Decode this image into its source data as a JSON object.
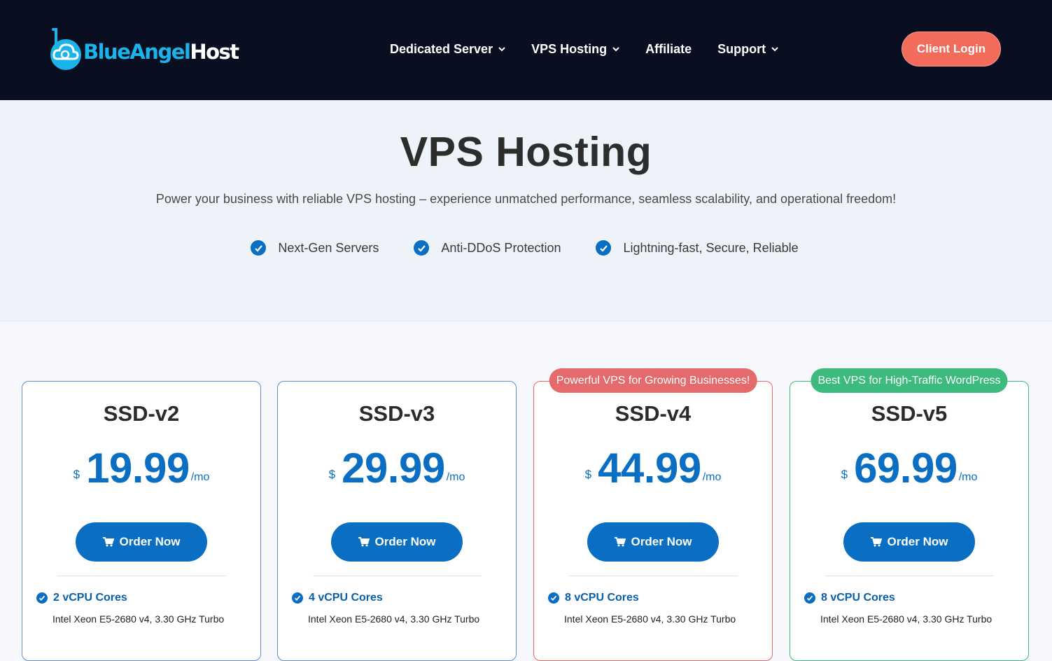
{
  "header": {
    "logo": {
      "part1": "BlueAngel",
      "part2": "Host"
    },
    "nav": [
      {
        "label": "Dedicated Server",
        "has_dropdown": true
      },
      {
        "label": "VPS Hosting",
        "has_dropdown": true
      },
      {
        "label": "Affiliate",
        "has_dropdown": false
      },
      {
        "label": "Support",
        "has_dropdown": true
      }
    ],
    "client_login": "Client Login"
  },
  "hero": {
    "title": "VPS Hosting",
    "subtitle": "Power your business with reliable VPS hosting – experience unmatched performance, seamless scalability, and operational freedom!",
    "features": [
      "Next-Gen Servers",
      "Anti-DDoS Protection",
      "Lightning-fast, Secure, Reliable"
    ]
  },
  "plans": [
    {
      "name": "SSD-v2",
      "currency": "$",
      "price": "19.99",
      "period": "/mo",
      "order_label": "Order Now",
      "ribbon": "",
      "feature": {
        "title": "2 vCPU Cores",
        "detail": "Intel Xeon E5-2680 v4, 3.30 GHz Turbo"
      }
    },
    {
      "name": "SSD-v3",
      "currency": "$",
      "price": "29.99",
      "period": "/mo",
      "order_label": "Order Now",
      "ribbon": "",
      "feature": {
        "title": "4 vCPU Cores",
        "detail": "Intel Xeon E5-2680 v4, 3.30 GHz Turbo"
      }
    },
    {
      "name": "SSD-v4",
      "currency": "$",
      "price": "44.99",
      "period": "/mo",
      "order_label": "Order Now",
      "ribbon": "Powerful VPS for Growing Businesses!",
      "feature": {
        "title": "8 vCPU Cores",
        "detail": "Intel Xeon E5-2680 v4, 3.30 GHz Turbo"
      }
    },
    {
      "name": "SSD-v5",
      "currency": "$",
      "price": "69.99",
      "period": "/mo",
      "order_label": "Order Now",
      "ribbon": "Best VPS for High-Traffic WordPress",
      "feature": {
        "title": "8 vCPU Cores",
        "detail": "Intel Xeon E5-2680 v4, 3.30 GHz Turbo"
      }
    }
  ],
  "colors": {
    "header_bg": "#090f21",
    "accent_blue": "#0a6fc2",
    "login_coral": "#f26b5b",
    "ribbon_red": "#e46a6c",
    "ribbon_green": "#3dbb7e",
    "logo_blue": "#1ab3ea"
  },
  "icons": [
    "logo-cloud-icon",
    "chevron-down-icon",
    "check-circle-icon",
    "shopping-cart-icon"
  ]
}
